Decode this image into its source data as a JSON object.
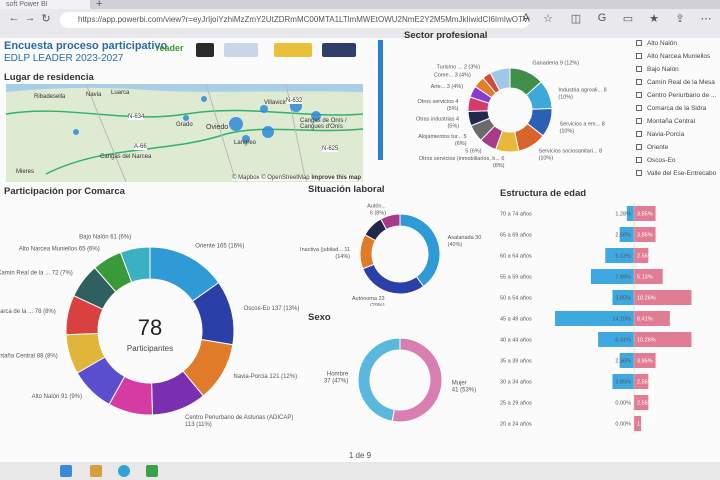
{
  "browser": {
    "tab_title": "soft Power BI",
    "url": "https://app.powerbi.com/view?r=eyJrIjoiYzhiMzZmY2UtZDRmMC00MTA1LTlmMWEtOWU2NmE2Y2M5MmJkIiwidCI6ImIwOTViNzZhLTAzZDYtNGM"
  },
  "header": {
    "title": "Encuesta proceso participativo",
    "subtitle": "EDLP LEADER 2023-2027",
    "logo_text": "reader"
  },
  "map": {
    "title": "Lugar de residencia",
    "labels": [
      "Ribadesella",
      "Navia",
      "Luarca",
      "Villaviciosa",
      "Grado",
      "Oviedo",
      "Langreo",
      "Cangas de Onís / Cangues d'Onís",
      "Cangas del Narcea",
      "Mieres"
    ],
    "roads": [
      "N-634",
      "N-632",
      "A-66",
      "N-625"
    ],
    "attribution": "© Mapbox © OpenStreetMap",
    "improve": "Improve this map"
  },
  "sector": {
    "title": "Sector profesional",
    "slices": [
      {
        "label": "Ganadería 9 (12%)",
        "value": 12,
        "color": "#3f8f4a"
      },
      {
        "label": "Industria agroali... 8 (10%)",
        "value": 10,
        "color": "#3ea8d8"
      },
      {
        "label": "Servicios a em... 8 (10%)",
        "value": 10,
        "color": "#2b5fb8"
      },
      {
        "label": "Servicios sociosanitari... 8 (10%)",
        "value": 10,
        "color": "#d9652b"
      },
      {
        "label": "Otros servicios (inmobiliarios, b... 6 (8%)",
        "value": 8,
        "color": "#e8b83a"
      },
      {
        "label": "5 (6%)",
        "value": 6,
        "color": "#a83a8a"
      },
      {
        "label": "Alojamientos tur... 5 (6%)",
        "value": 6,
        "color": "#6b6b6b"
      },
      {
        "label": "Otras industrias 4 (5%)",
        "value": 5,
        "color": "#1f2a4a"
      },
      {
        "label": "Otros servicios 4 (5%)",
        "value": 5,
        "color": "#d43a6a"
      },
      {
        "label": "Arte... 3 (4%)",
        "value": 4,
        "color": "#8a3ad0"
      },
      {
        "label": "Come... 3 (4%)",
        "value": 4,
        "color": "#e37d2a"
      },
      {
        "label": "Turismo ... 2 (3%)",
        "value": 3,
        "color": "#d24a3a"
      },
      {
        "label": "",
        "value": 7,
        "color": "#9ec7e8"
      }
    ]
  },
  "slicer": {
    "items": [
      "Alto Nalón",
      "Alto Narcea Muniellos",
      "Bajo Nalón",
      "Camín Real de la Mesa",
      "Centro Periurbano de ...",
      "Comarca de la Sidra",
      "Montaña Central",
      "Navia-Porcia",
      "Oriente",
      "Oscos-Eo",
      "Valle del Ese-Entrecabo"
    ]
  },
  "comarca": {
    "title": "Participación por Comarca",
    "center_value": "78",
    "center_label": "Participantes",
    "slices": [
      {
        "label": "Oriente 165 (16%)",
        "value": 16,
        "color": "#2e9bd6"
      },
      {
        "label": "Oscos-Eo 137 (13%)",
        "value": 13,
        "color": "#2b3fa8"
      },
      {
        "label": "Navia-Porcia 121 (12%)",
        "value": 12,
        "color": "#e07b2a"
      },
      {
        "label": "Centro Periurbano de Asturias (ADICAP) 113 (11%)",
        "value": 11,
        "color": "#7a2fb0"
      },
      {
        "label": "",
        "value": 9,
        "color": "#d63aa3"
      },
      {
        "label": "Alto Nalón 91 (9%)",
        "value": 9,
        "color": "#5b4fd0"
      },
      {
        "label": "Montaña Central 88 (8%)",
        "value": 8,
        "color": "#e0b63a"
      },
      {
        "label": "Comarca de la ... 78 (8%)",
        "value": 8,
        "color": "#d94040"
      },
      {
        "label": "Camín Real de la ... 72 (7%)",
        "value": 7,
        "color": "#2f5f5f"
      },
      {
        "label": "Alto Narcea Muniellos 65 (6%)",
        "value": 6,
        "color": "#3a9a3a"
      },
      {
        "label": "Bajo Nalón 61 (6%)",
        "value": 6,
        "color": "#3ab0c0"
      }
    ]
  },
  "laboral": {
    "title": "Situación laboral",
    "slices": [
      {
        "label": "Asalariada 30 (40%)",
        "value": 40,
        "color": "#2e9bd6"
      },
      {
        "label": "Autónoma 23 (29%)",
        "value": 29,
        "color": "#2b3fa8"
      },
      {
        "label": "Inactiva (jubilad... 11 (14%)",
        "value": 14,
        "color": "#e07b2a"
      },
      {
        "label": "",
        "value": 9,
        "color": "#1f2a4a"
      },
      {
        "label": "Autón... 6 (8%)",
        "value": 8,
        "color": "#a83a8a"
      }
    ]
  },
  "sexo": {
    "title": "Sexo",
    "slices": [
      {
        "label": "Mujer 41 (53%)",
        "value": 53,
        "color": "#d97fb0"
      },
      {
        "label": "Hombre 37 (47%)",
        "value": 47,
        "color": "#5ab8dc"
      }
    ]
  },
  "edad": {
    "title": "Estructura de edad",
    "rows": [
      {
        "label": "70 a 74 años",
        "male": 1.28,
        "female": 3.85,
        "male_label": "1.28%",
        "female_label": "3.85%"
      },
      {
        "label": "65 a 69 años",
        "male": 2.56,
        "female": 3.85,
        "male_label": "2.56%",
        "female_label": "3.85%"
      },
      {
        "label": "60 a 64 años",
        "male": 5.13,
        "female": 2.56,
        "male_label": "5.13%",
        "female_label": "2.56%"
      },
      {
        "label": "55 a 59 años",
        "male": 7.69,
        "female": 5.13,
        "male_label": "7.69%",
        "female_label": "5.13%"
      },
      {
        "label": "50 a 54 años",
        "male": 3.85,
        "female": 10.26,
        "male_label": "3.85%",
        "female_label": "10.26%"
      },
      {
        "label": "45 a 49 años",
        "male": 14.1,
        "female": 6.41,
        "male_label": "14.10%",
        "female_label": "6.41%"
      },
      {
        "label": "40 a 44 años",
        "male": 6.41,
        "female": 10.26,
        "male_label": "6.41%",
        "female_label": "10.26%"
      },
      {
        "label": "35 a 39 años",
        "male": 2.56,
        "female": 3.85,
        "male_label": "2.56%",
        "female_label": "3.85%"
      },
      {
        "label": "30 a 34 años",
        "male": 3.85,
        "female": 2.56,
        "male_label": "3.85%",
        "female_label": "2.56%"
      },
      {
        "label": "25 a 29 años",
        "male": 0.0,
        "female": 2.56,
        "male_label": "0.00%",
        "female_label": "2.56%"
      },
      {
        "label": "20 a 24 años",
        "male": 0.0,
        "female": 1.28,
        "male_label": "0.00%",
        "female_label": "1.28%"
      }
    ],
    "male_color": "#3ea8e0",
    "female_color": "#e07d95"
  },
  "footer": {
    "page": "1 de 9"
  }
}
